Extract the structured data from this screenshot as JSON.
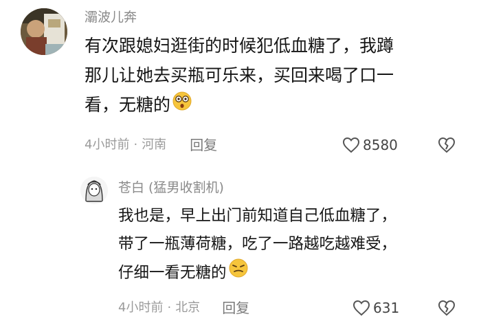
{
  "comment": {
    "username": "灞波儿奔",
    "text_lines": [
      "有次跟媳妇逛街的时候犯低血糖了，我蹲",
      "那儿让她去买瓶可乐来，买回来喝了口一",
      "看，无糖的"
    ],
    "emoji": "shocked-face-emoji",
    "time": "4小时前",
    "location": "河南",
    "reply_label": "回复",
    "like_count": "8580"
  },
  "reply": {
    "username": "苍白 (猛男收割机)",
    "text_lines": [
      "我也是，早上出门前知道自己低血糖了，",
      "带了一瓶薄荷糖，吃了一路越吃越难受，",
      "仔细一看无糖的"
    ],
    "emoji": "grimacing-face-emoji",
    "time": "4小时前",
    "location": "北京",
    "reply_label": "回复",
    "like_count": "631"
  },
  "separator": "·",
  "colors": {
    "meta": "#9a9a9a",
    "emoji_yellow": "#f6c53c"
  }
}
